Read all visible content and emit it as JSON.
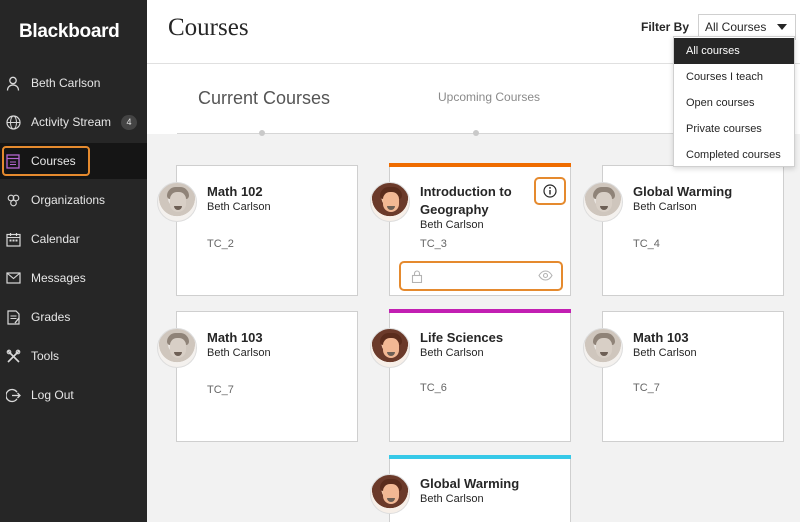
{
  "app": {
    "logo": "Blackboard"
  },
  "sidebar": {
    "items": [
      {
        "label": "Beth Carlson",
        "icon": "user-icon"
      },
      {
        "label": "Activity Stream",
        "icon": "globe-icon",
        "badge": "4"
      },
      {
        "label": "Courses",
        "icon": "courses-icon",
        "active": true
      },
      {
        "label": "Organizations",
        "icon": "organizations-icon"
      },
      {
        "label": "Calendar",
        "icon": "calendar-icon"
      },
      {
        "label": "Messages",
        "icon": "envelope-icon"
      },
      {
        "label": "Grades",
        "icon": "grades-icon"
      },
      {
        "label": "Tools",
        "icon": "tools-icon"
      },
      {
        "label": "Log Out",
        "icon": "logout-icon"
      }
    ]
  },
  "header": {
    "title": "Courses",
    "filter_label": "Filter By",
    "filter_value": "All Courses",
    "filter_options": [
      "All courses",
      "Courses I teach",
      "Open courses",
      "Private courses",
      "Completed courses"
    ]
  },
  "tabs": {
    "current": "Current Courses",
    "upcoming": "Upcoming Courses"
  },
  "courses": [
    {
      "title": "Math 102",
      "instructor": "Beth Carlson",
      "id": "TC_2"
    },
    {
      "title": "Introduction to Geography",
      "instructor": "Beth Carlson",
      "id": "TC_3",
      "accent": "#ef6c00"
    },
    {
      "title": "Global Warming",
      "instructor": "Beth Carlson",
      "id": "TC_4"
    },
    {
      "title": "Math 103",
      "instructor": "Beth Carlson",
      "id": "TC_7"
    },
    {
      "title": "Life Sciences",
      "instructor": "Beth Carlson",
      "id": "TC_6",
      "accent": "#c21fb2"
    },
    {
      "title": "Math 103",
      "instructor": "Beth Carlson",
      "id": "TC_7"
    },
    {
      "title": "Global Warming",
      "instructor": "Beth Carlson",
      "accent": "#36c9e8"
    }
  ],
  "colors": {
    "focus_outline": "#e58a2e",
    "sidebar_bg": "#262626",
    "active_icon": "#b566d1"
  }
}
